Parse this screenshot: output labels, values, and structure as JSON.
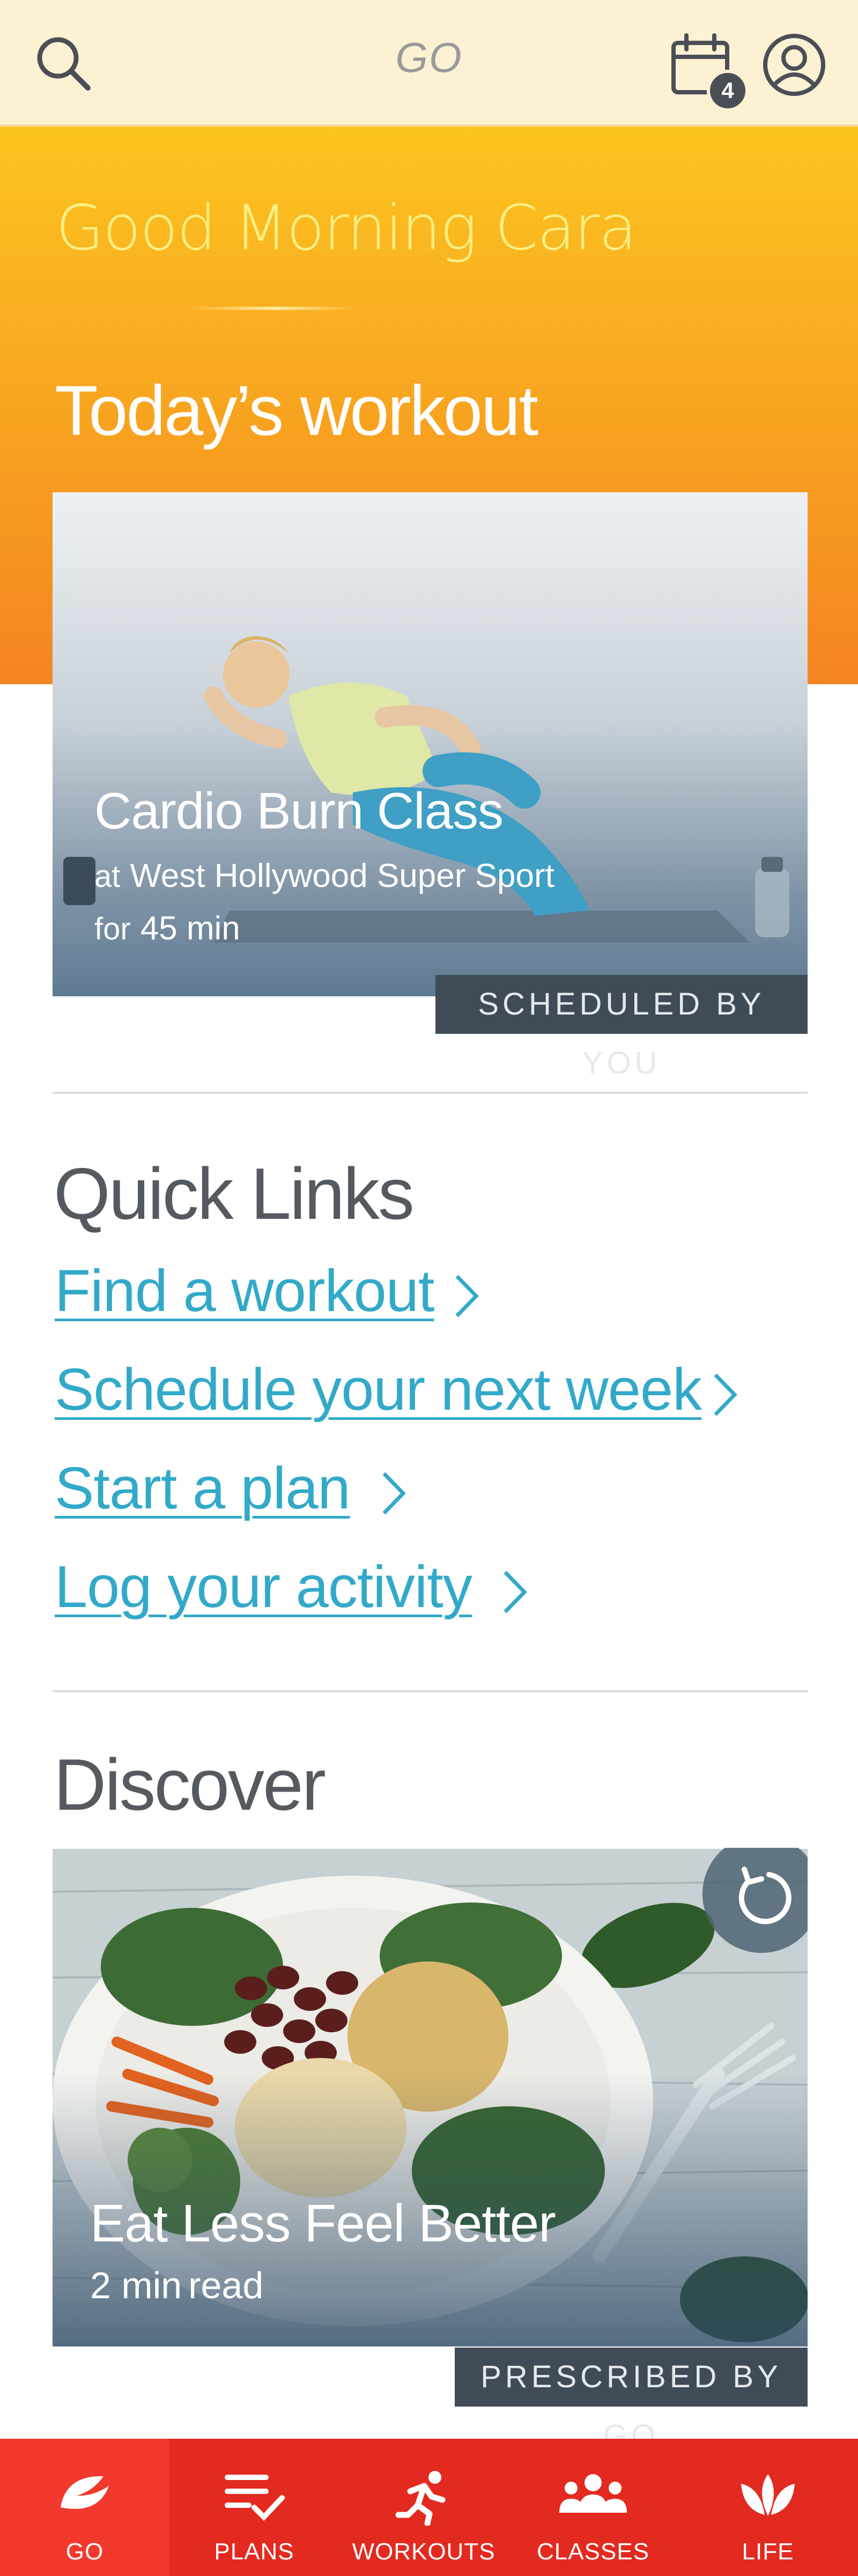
{
  "topbar": {
    "brand": "GO",
    "calendar_badge": "4",
    "icons": [
      "search-icon",
      "calendar-icon",
      "profile-icon"
    ]
  },
  "hero": {
    "greeting": "Good Morning Cara",
    "today_title": "Today’s workout"
  },
  "workout_card": {
    "title": "Cardio Burn Class",
    "location_prefix": "at",
    "location": "West Hollywood Super Sport",
    "duration_prefix": "for",
    "duration": "45 min",
    "tag": "SCHEDULED BY YOU"
  },
  "quick_links": {
    "title": "Quick Links",
    "items": [
      {
        "label": "Find a workout"
      },
      {
        "label": "Schedule your next week"
      },
      {
        "label": "Start a plan"
      },
      {
        "label": "Log your activity"
      }
    ]
  },
  "discover": {
    "title": "Discover",
    "card_title": "Eat Less Feel Better",
    "read_time": "2 min",
    "read_suffix": "read",
    "tag": "PRESCRIBED BY GO"
  },
  "bottom_nav": {
    "items": [
      {
        "label": "GO",
        "icon": "go-logo-icon",
        "active": true
      },
      {
        "label": "PLANS",
        "icon": "plans-checklist-icon"
      },
      {
        "label": "WORKOUTS",
        "icon": "running-icon"
      },
      {
        "label": "CLASSES",
        "icon": "group-icon"
      },
      {
        "label": "LIFE",
        "icon": "lotus-icon"
      }
    ]
  },
  "colors": {
    "topbar_bg": "#fdf1d3",
    "hero_top": "#fcc51f",
    "hero_bottom": "#f47e22",
    "link": "#33a9c9",
    "nav_bg": "#e32a20",
    "tag_bg": "#3f4b57"
  }
}
